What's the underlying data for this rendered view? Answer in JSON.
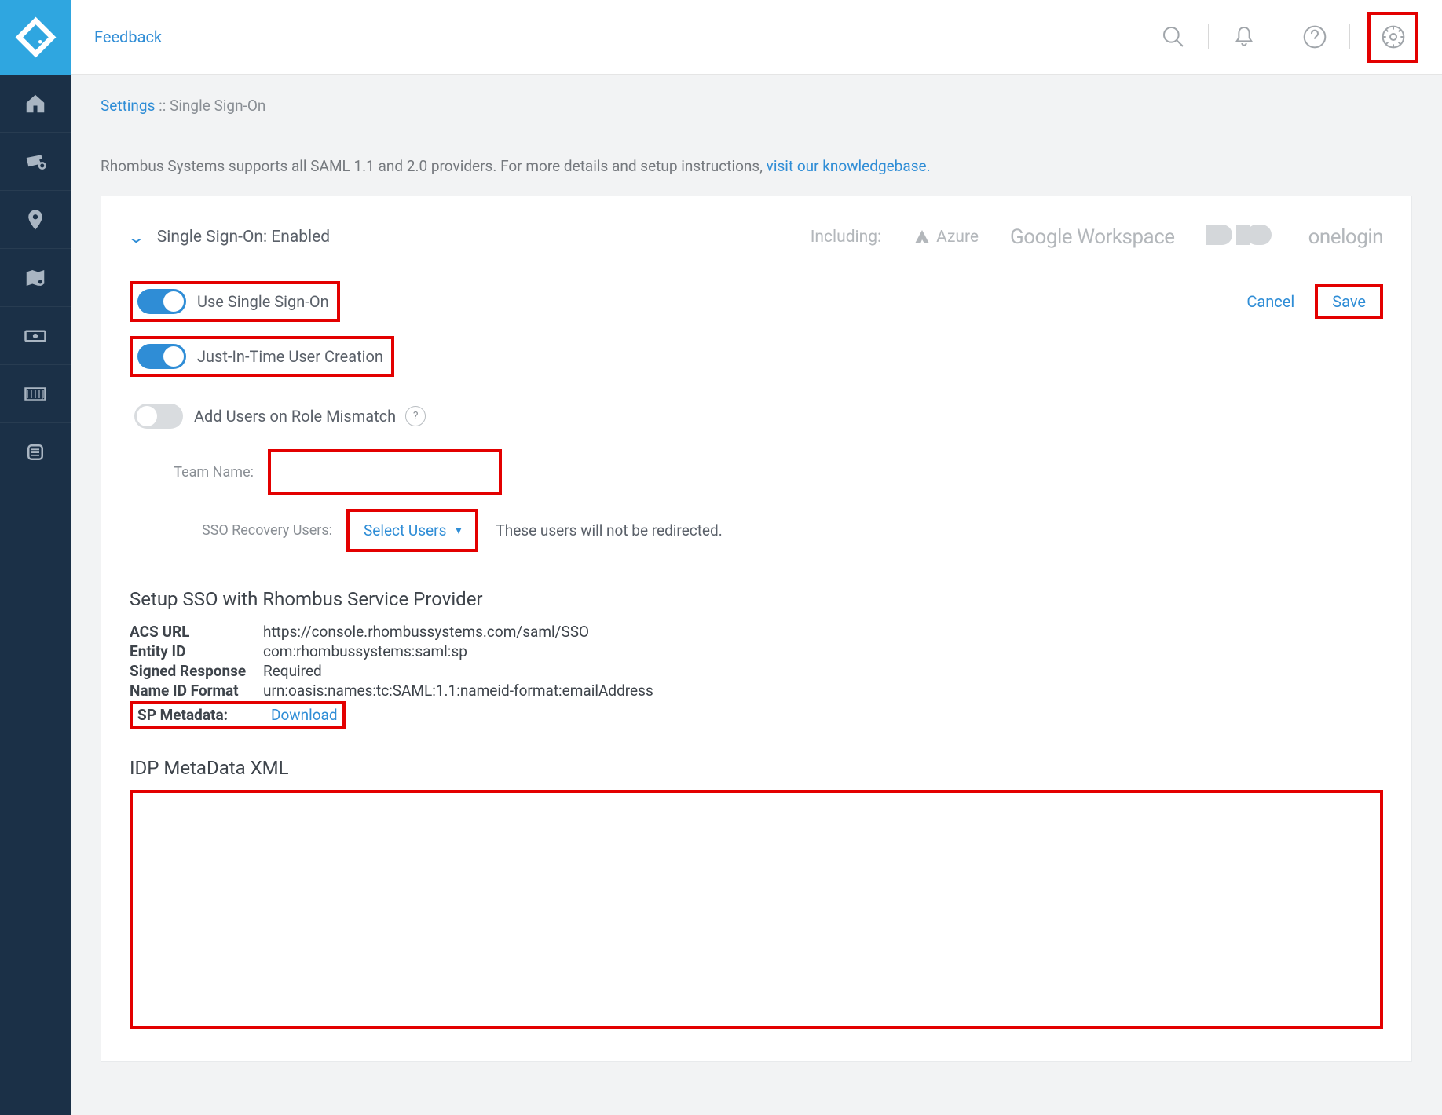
{
  "topbar": {
    "feedback": "Feedback"
  },
  "breadcrumb": {
    "root": "Settings",
    "sep": " :: ",
    "page": "Single Sign-On"
  },
  "notice": {
    "text": "Rhombus Systems supports all SAML 1.1 and 2.0 providers. For more details and setup instructions, ",
    "link": "visit our knowledgebase."
  },
  "panel": {
    "title": "Single Sign-On: Enabled",
    "including": "Including:",
    "providers": {
      "azure": "Azure",
      "google": "Google Workspace",
      "duo": "DUO",
      "onelogin": "onelogin"
    },
    "cancel": "Cancel",
    "save": "Save"
  },
  "toggles": {
    "use_sso": "Use Single Sign-On",
    "jit": "Just-In-Time User Creation",
    "mismatch": "Add Users on Role Mismatch"
  },
  "fields": {
    "team_name_label": "Team Name:",
    "team_name_value": "",
    "recovery_label": "SSO Recovery Users:",
    "select_users": "Select Users",
    "recovery_hint": "These users will not be redirected."
  },
  "sp": {
    "title": "Setup SSO with Rhombus Service Provider",
    "acs_key": "ACS URL",
    "acs_val": "https://console.rhombussystems.com/saml/SSO",
    "entity_key": "Entity ID",
    "entity_val": "com:rhombussystems:saml:sp",
    "signed_key": "Signed Response",
    "signed_val": "Required",
    "nameid_key": "Name ID Format",
    "nameid_val": "urn:oasis:names:tc:SAML:1.1:nameid-format:emailAddress",
    "meta_key": "SP Metadata:",
    "meta_val": "Download"
  },
  "idp": {
    "title": "IDP MetaData XML",
    "value": ""
  }
}
